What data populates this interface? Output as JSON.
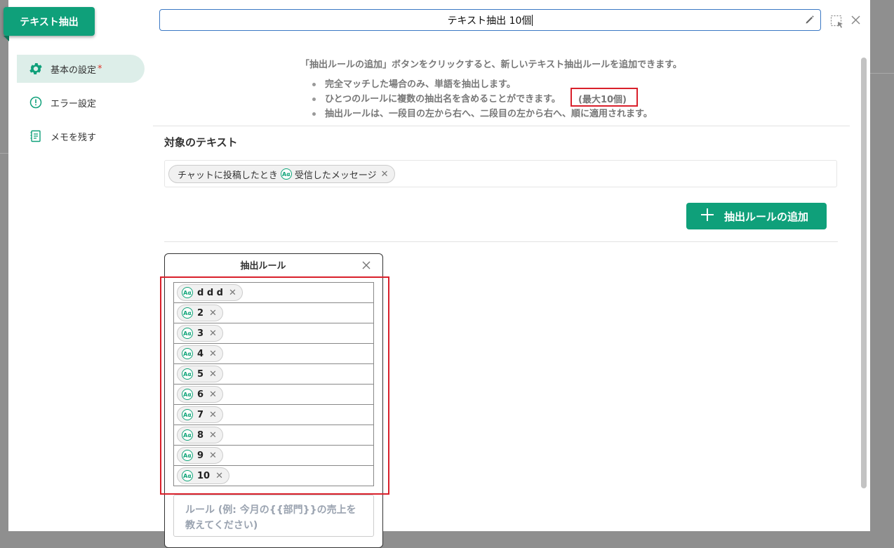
{
  "app": {
    "badge": "テキスト抽出",
    "title_value": "テキスト抽出 10個"
  },
  "sidebar": {
    "items": [
      {
        "label": "基本の設定",
        "required_mark": "*",
        "icon": "gear-icon",
        "active": true
      },
      {
        "label": "エラー設定",
        "icon": "alert-circle-icon",
        "active": false
      },
      {
        "label": "メモを残す",
        "icon": "memo-icon",
        "active": false
      }
    ]
  },
  "info": {
    "intro": "「抽出ルールの追加」ボタンをクリックすると、新しいテキスト抽出ルールを追加できます。",
    "bullets": [
      "完全マッチした場合のみ、単語を抽出します。",
      "ひとつのルールに複数の抽出名を含めることができます。",
      "抽出ルールは、一段目の左から右へ、二段目の左から右へ、順に適用されます。"
    ],
    "max_note": "(最大10個)"
  },
  "target": {
    "section_title": "対象のテキスト",
    "pill_source": "チャットに投稿したとき",
    "pill_field": "受信したメッセージ"
  },
  "add_rule_button": "抽出ルールの追加",
  "rule_card": {
    "title": "抽出ルール",
    "items": [
      "d d d",
      "2",
      "3",
      "4",
      "5",
      "6",
      "7",
      "8",
      "9",
      "10"
    ],
    "input_placeholder": "ルール (例: 今月の{{部門}}の売上を教えてください)"
  },
  "colors": {
    "accent": "#0fa07a",
    "highlight": "#d9202b",
    "focus_border": "#3b78c4"
  }
}
